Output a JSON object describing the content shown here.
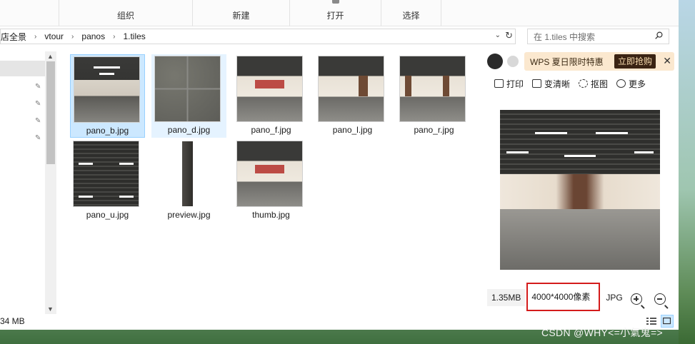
{
  "ribbon": {
    "groups": [
      {
        "label": "组织"
      },
      {
        "label": "新建"
      },
      {
        "label": "打开"
      },
      {
        "label": "选择"
      }
    ]
  },
  "address": {
    "crumbs": [
      "店全景",
      "vtour",
      "panos",
      "1.tiles"
    ]
  },
  "search": {
    "placeholder": "在 1.tiles 中搜索"
  },
  "files": [
    {
      "name": "pano_b.jpg",
      "state": "selected"
    },
    {
      "name": "pano_d.jpg",
      "state": "hovered"
    },
    {
      "name": "pano_f.jpg",
      "state": "normal"
    },
    {
      "name": "pano_l.jpg",
      "state": "normal"
    },
    {
      "name": "pano_r.jpg",
      "state": "normal"
    },
    {
      "name": "pano_u.jpg",
      "state": "normal"
    },
    {
      "name": "preview.jpg",
      "state": "normal"
    },
    {
      "name": "thumb.jpg",
      "state": "normal"
    }
  ],
  "preview": {
    "promo_text": "WPS 夏日限时特惠",
    "promo_button": "立即抢购",
    "toolbar": {
      "print": "打印",
      "sharpen": "变清晰",
      "cutout": "抠图",
      "more": "更多"
    },
    "info": {
      "size": "1.35MB",
      "dimensions": "4000*4000像素",
      "format": "JPG"
    }
  },
  "status": {
    "size_text": "34 MB"
  },
  "watermark": "CSDN @WHY<=小氣鬼=>"
}
